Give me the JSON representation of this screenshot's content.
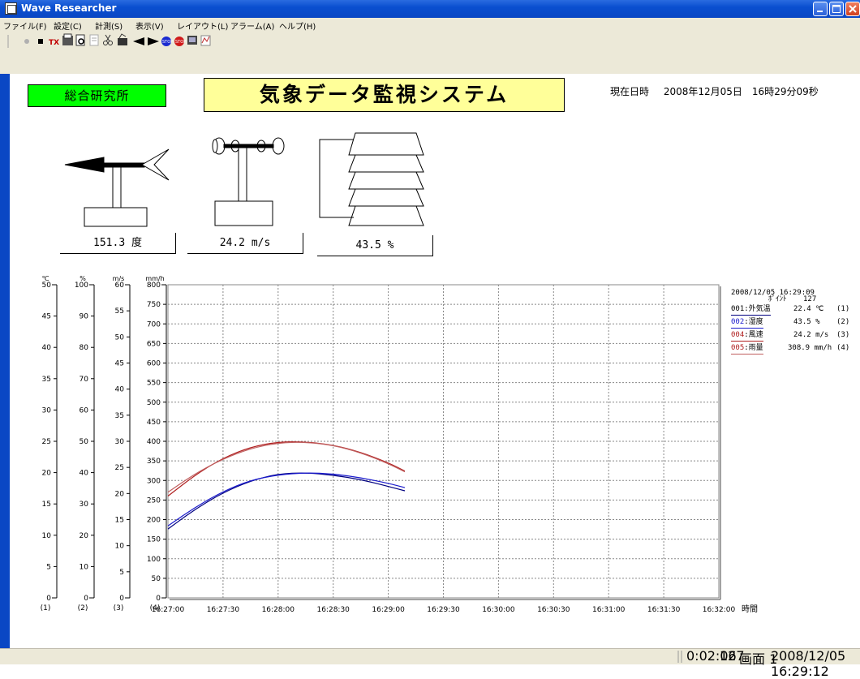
{
  "window": {
    "title": "Wave Researcher"
  },
  "menu": [
    "ファイル(F)",
    "設定(C)",
    "計測(S)",
    "表示(V)",
    "レイアウト(L)",
    "アラーム(A)",
    "ヘルプ(H)"
  ],
  "header": {
    "org_label": "総合研究所",
    "system_title": "気象データ監視システム",
    "datetime_label": "現在日時",
    "datetime_value": "2008年12月05日　16時29分09秒"
  },
  "sensors": {
    "wind_direction": "151.3 度",
    "wind_speed": "24.2 m/s",
    "humidity": "43.5 %"
  },
  "legend": {
    "timestamp": "2008/12/05 16:29:09",
    "point_label": "ﾎﾟｲﾝﾄ",
    "point_value": "127",
    "rows": [
      {
        "id": "001",
        "name": ":外気温",
        "value": "22.4 ℃",
        "axis": "(1)",
        "color": "#000000"
      },
      {
        "id": "002",
        "name": ":湿度",
        "value": "43.5 %",
        "axis": "(2)",
        "color": "#1a1aa0"
      },
      {
        "id": "004",
        "name": ":風速",
        "value": "24.2 m/s",
        "axis": "(3)",
        "color": "#a01a1a"
      },
      {
        "id": "005",
        "name": ":雨量",
        "value": "308.9 mm/h",
        "axis": "(4)",
        "color": "#a01a1a"
      }
    ]
  },
  "status": {
    "elapsed": "0:02:06",
    "points": "127",
    "screen": "画面 1",
    "datetime": "2008/12/05 16:29:12"
  },
  "colors": {
    "ch1": "#000080",
    "ch2": "#1a1acc",
    "ch3": "#b02020",
    "ch4": "#c06060"
  },
  "chart_data": {
    "type": "line",
    "xlabel": "時間",
    "x_ticks": [
      "16:27:00",
      "16:27:30",
      "16:28:00",
      "16:28:30",
      "16:29:00",
      "16:29:30",
      "16:30:00",
      "16:30:30",
      "16:31:00",
      "16:31:30",
      "16:32:00"
    ],
    "axes": [
      {
        "unit": "℃",
        "label": "(1)",
        "min": 0,
        "max": 50,
        "ticks": [
          0,
          5,
          10,
          15,
          20,
          25,
          30,
          35,
          40,
          45,
          50
        ]
      },
      {
        "unit": "%",
        "label": "(2)",
        "min": 0,
        "max": 100,
        "ticks": [
          0,
          10,
          20,
          30,
          40,
          50,
          60,
          70,
          80,
          90,
          100
        ]
      },
      {
        "unit": "m/s",
        "label": "(3)",
        "min": 0,
        "max": 60,
        "ticks": [
          0,
          5,
          10,
          15,
          20,
          25,
          30,
          35,
          40,
          45,
          50,
          55,
          60
        ]
      },
      {
        "unit": "mm/h",
        "label": "(4)",
        "min": 0,
        "max": 800,
        "ticks": [
          0,
          50,
          100,
          150,
          200,
          250,
          300,
          350,
          400,
          450,
          500,
          550,
          600,
          650,
          700,
          750,
          800
        ]
      }
    ],
    "x_seconds_range": [
      0,
      300
    ],
    "series": [
      {
        "name": "001:外気温",
        "axis": 1,
        "color": "#000080",
        "x": [
          0,
          15,
          30,
          45,
          60,
          75,
          90,
          105,
          120,
          129
        ],
        "y": [
          11.0,
          14.2,
          16.8,
          18.7,
          19.8,
          20.0,
          19.6,
          18.9,
          17.8,
          17.1
        ]
      },
      {
        "name": "002:湿度",
        "axis": 2,
        "color": "#1a1acc",
        "x": [
          0,
          15,
          30,
          45,
          60,
          75,
          90,
          105,
          120,
          129
        ],
        "y": [
          23.0,
          29.0,
          34.0,
          37.6,
          39.3,
          40.0,
          39.6,
          38.4,
          36.6,
          35.2
        ]
      },
      {
        "name": "004:風速",
        "axis": 3,
        "color": "#b02020",
        "x": [
          0,
          15,
          30,
          45,
          60,
          75,
          90,
          105,
          120,
          129
        ],
        "y": [
          19.5,
          23.6,
          26.8,
          28.9,
          29.9,
          29.9,
          29.3,
          27.9,
          25.9,
          24.3
        ]
      },
      {
        "name": "005:雨量",
        "axis": 4,
        "color": "#c06060",
        "x": [
          0,
          15,
          30,
          45,
          60,
          75,
          90,
          105,
          120,
          129
        ],
        "y": [
          270,
          318,
          355,
          382,
          396,
          398,
          390,
          371,
          343,
          322
        ]
      }
    ]
  }
}
